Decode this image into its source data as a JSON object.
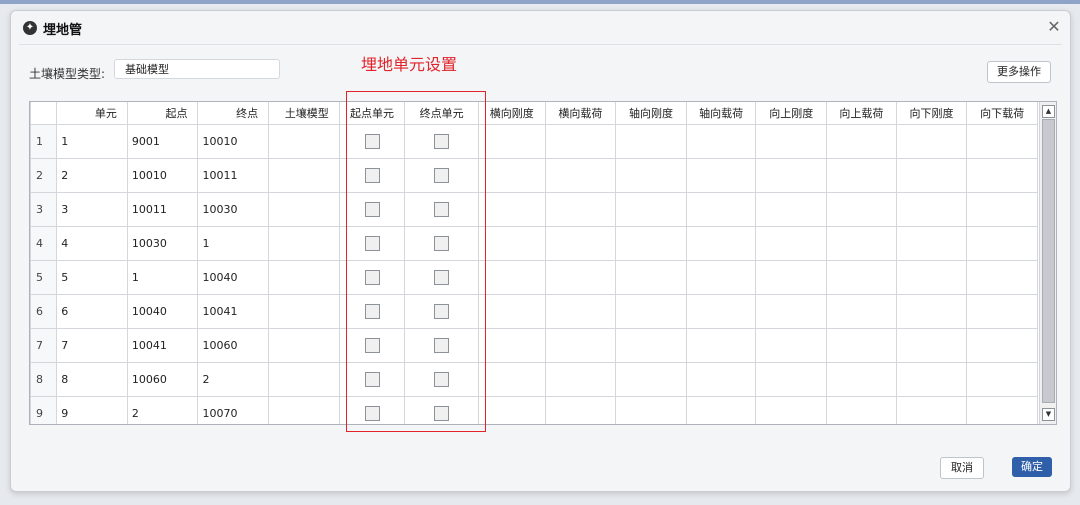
{
  "window": {
    "title": "埋地管"
  },
  "soil": {
    "label": "土壤模型类型:",
    "value": "基础模型"
  },
  "annotation": "埋地单元设置",
  "toolbar": {
    "more_label": "更多操作"
  },
  "table": {
    "columns": [
      "单元",
      "起点",
      "终点",
      "土壤模型",
      "起点单元",
      "终点单元",
      "横向刚度",
      "横向载荷",
      "轴向刚度",
      "轴向载荷",
      "向上刚度",
      "向上载荷",
      "向下刚度",
      "向下载荷"
    ],
    "rows": [
      {
        "num": "1",
        "unit": "1",
        "start": "9001",
        "end": "10010"
      },
      {
        "num": "2",
        "unit": "2",
        "start": "10010",
        "end": "10011"
      },
      {
        "num": "3",
        "unit": "3",
        "start": "10011",
        "end": "10030"
      },
      {
        "num": "4",
        "unit": "4",
        "start": "10030",
        "end": "1"
      },
      {
        "num": "5",
        "unit": "5",
        "start": "1",
        "end": "10040"
      },
      {
        "num": "6",
        "unit": "6",
        "start": "10040",
        "end": "10041"
      },
      {
        "num": "7",
        "unit": "7",
        "start": "10041",
        "end": "10060"
      },
      {
        "num": "8",
        "unit": "8",
        "start": "10060",
        "end": "2"
      },
      {
        "num": "9",
        "unit": "9",
        "start": "2",
        "end": "10070"
      }
    ]
  },
  "footer": {
    "cancel_label": "取消",
    "ok_label": "确定"
  },
  "colors": {
    "accent": "#2f5fa8",
    "annotation": "#e0242a"
  },
  "icons": {
    "app": "app-logo-icon",
    "close": "close-icon"
  }
}
